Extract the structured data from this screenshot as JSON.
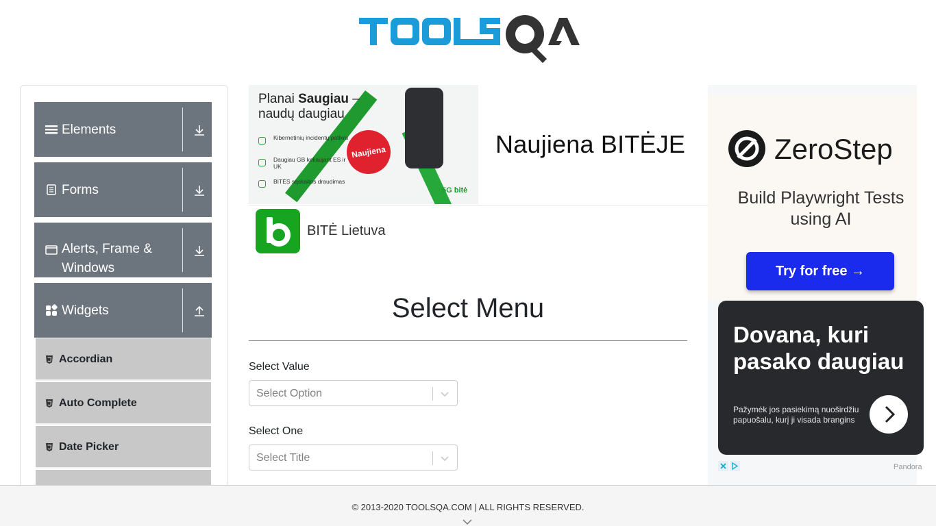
{
  "logo": {
    "text": "TOOLSQA"
  },
  "sidebar": {
    "groups": [
      {
        "label": "Elements",
        "icon": "hamburger-icon",
        "arrow": "download-arrow-icon"
      },
      {
        "label": "Forms",
        "icon": "document-icon",
        "arrow": "download-arrow-icon"
      },
      {
        "label": "Alerts, Frame & Windows",
        "icon": "window-icon",
        "arrow": "download-arrow-icon"
      },
      {
        "label": "Widgets",
        "icon": "grid-icon",
        "arrow": "upload-arrow-icon"
      }
    ],
    "widget_items": [
      "Accordian",
      "Auto Complete",
      "Date Picker"
    ]
  },
  "ad_top": {
    "image_title_part1": "Planai ",
    "image_title_bold": "Saugiau",
    "image_title_part2": " –",
    "image_title_line2": "naudų daugiau",
    "features": [
      "Kibernetinių incidentų patikra",
      "Daugiau GB keliaujant ES ir UK",
      "BITĖS sąskaitos draudimas"
    ],
    "badge": "Naujiena",
    "mark": "5G bitė",
    "headline": "Naujiena BITĖJE",
    "brand": "BITĖ Lietuva"
  },
  "main": {
    "title": "Select Menu",
    "fields": [
      {
        "label": "Select Value",
        "placeholder": "Select Option"
      },
      {
        "label": "Select One",
        "placeholder": "Select Title"
      }
    ]
  },
  "ad_right": {
    "brand": "ZeroStep",
    "tagline": "Build Playwright Tests using AI",
    "button": "Try for free →",
    "promo_headline": "Dovana, kuri pasako daugiau",
    "promo_sub": "Pažymėk jos pasiekimą nuoširdžiu papuošalu, kurį ji visada brangins",
    "promo_source": "Pandora"
  },
  "footer": {
    "copyright": "© 2013-2020 TOOLSQA.COM | ALL RIGHTS RESERVED."
  },
  "colors": {
    "group_bg": "#6c757d",
    "subitem_bg": "#c8c8c8",
    "logo_blue": "#1b9bd7",
    "cta_blue": "#1a2bee"
  }
}
